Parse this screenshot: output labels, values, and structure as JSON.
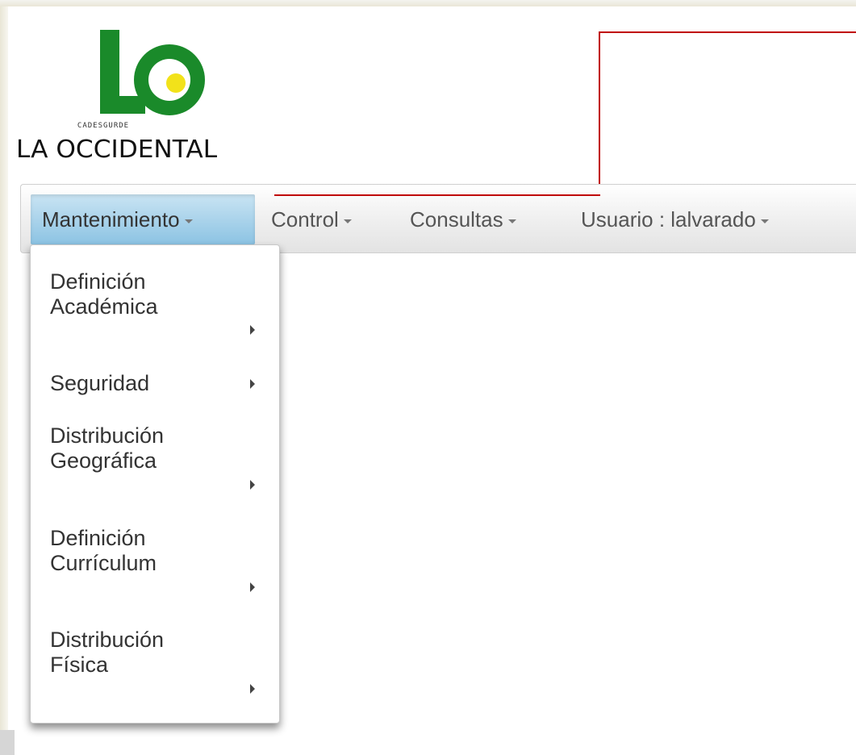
{
  "logo": {
    "tagline": "CADESGURDE",
    "brand": "LA OCCIDENTAL",
    "colors": {
      "green": "#1a8a2a",
      "yellow": "#f2e21a"
    }
  },
  "navbar": {
    "items": [
      {
        "label": "Mantenimiento",
        "active": true
      },
      {
        "label": "Control",
        "active": false
      },
      {
        "label": "Consultas",
        "active": false
      },
      {
        "label": "Usuario : lalvarado",
        "active": false
      }
    ]
  },
  "dropdown": {
    "items": [
      {
        "line1": "Definición",
        "line2": "Académica",
        "has_submenu": true
      },
      {
        "line1": "Seguridad",
        "line2": "",
        "has_submenu": true
      },
      {
        "line1": "Distribución",
        "line2": "Geográfica",
        "has_submenu": true
      },
      {
        "line1": "Definición",
        "line2": "Currículum",
        "has_submenu": true
      },
      {
        "line1": "Distribución",
        "line2": "Física",
        "has_submenu": true
      }
    ]
  },
  "colors": {
    "accent_line": "#c00000",
    "active_tab": "#8cc3e3"
  },
  "icons": {
    "caret": "chevron-down-icon",
    "submenu": "chevron-right-icon"
  }
}
